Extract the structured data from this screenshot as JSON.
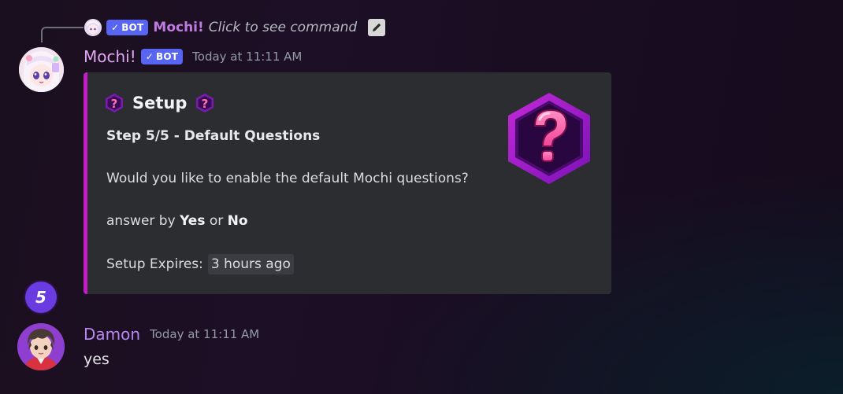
{
  "reply": {
    "bot_tag": "BOT",
    "author": "Mochi!",
    "content": "Click to see command"
  },
  "message1": {
    "author": "Mochi!",
    "bot_tag": "BOT",
    "timestamp": "Today at 11:11 AM",
    "embed": {
      "title": "Setup",
      "step": "Step 5/5 - Default Questions",
      "question": "Would you like to enable the default Mochi questions?",
      "answer_prefix": "answer by",
      "answer_yes": "Yes",
      "answer_or": "or",
      "answer_no": "No",
      "expires_label": "Setup Expires:",
      "expires_value": "3 hours ago",
      "accent_color": "#c41cc4"
    }
  },
  "badge": {
    "count": "5"
  },
  "message2": {
    "author": "Damon",
    "timestamp": "Today at 11:11 AM",
    "content": "yes"
  },
  "icons": {
    "bot_check": "checkmark-icon",
    "edit": "pencil-icon",
    "embed_title_emoji": "question-mark-icon",
    "thumbnail": "hexagon-question-icon"
  },
  "colors": {
    "bot_tag": "#5865f2",
    "mochi_name": "#e0a7f2",
    "damon_name": "#b887f0",
    "embed_bg": "#2b2d31",
    "badge_bg": "#6a3be0"
  }
}
